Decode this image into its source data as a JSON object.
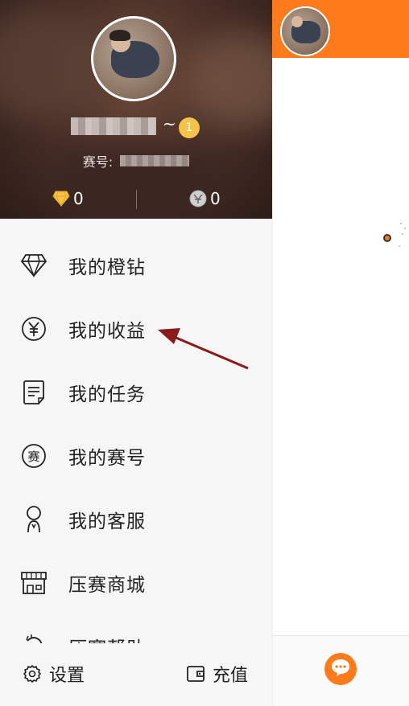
{
  "profile": {
    "tilde": "~",
    "level": "1",
    "id_label": "赛号:",
    "diamonds": "0",
    "coins": "0"
  },
  "menu": {
    "items": [
      {
        "label": "我的橙钻",
        "icon": "diamond-icon"
      },
      {
        "label": "我的收益",
        "icon": "yuan-icon"
      },
      {
        "label": "我的任务",
        "icon": "task-icon"
      },
      {
        "label": "我的赛号",
        "icon": "sai-badge-icon"
      },
      {
        "label": "我的客服",
        "icon": "customer-service-icon"
      },
      {
        "label": "压赛商城",
        "icon": "store-icon"
      },
      {
        "label": "压赛帮助",
        "icon": "help-icon"
      }
    ]
  },
  "bottom": {
    "settings_label": "设置",
    "recharge_label": "充值"
  },
  "colors": {
    "accent": "#ff7a1a",
    "arrow": "#8b1a1a",
    "text": "#222222",
    "gold": "#f5c24a"
  }
}
